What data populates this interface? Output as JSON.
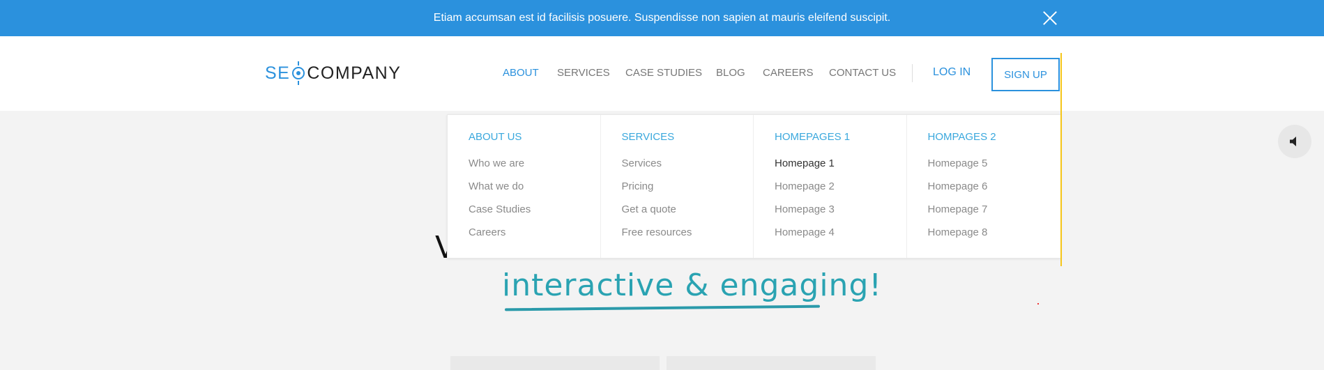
{
  "announcement": {
    "text": "Etiam accumsan est id facilisis posuere. Suspendisse non sapien at mauris eleifend suscipit.",
    "close_icon": "close-icon"
  },
  "logo": {
    "part1": "SE",
    "part2": "COMPANY"
  },
  "nav": {
    "items": [
      {
        "label": "ABOUT",
        "active": true
      },
      {
        "label": "SERVICES"
      },
      {
        "label": "CASE STUDIES"
      },
      {
        "label": "BLOG"
      },
      {
        "label": "CAREERS"
      },
      {
        "label": "CONTACT US"
      }
    ],
    "login": "LOG IN",
    "signup": "SIGN UP"
  },
  "megamenu": {
    "columns": [
      {
        "heading": "ABOUT US",
        "items": [
          "Who we are",
          "What we do",
          "Case Studies",
          "Careers"
        ]
      },
      {
        "heading": "SERVICES",
        "items": [
          "Services",
          "Pricing",
          "Get a quote",
          "Free resources"
        ]
      },
      {
        "heading": "HOMEPAGES 1",
        "items": [
          "Homepage 1",
          "Homepage 2",
          "Homepage 3",
          "Homepage 4"
        ],
        "current": "Homepage 1"
      },
      {
        "heading": "HOMPAGES 2",
        "items": [
          "Homepage 5",
          "Homepage 6",
          "Homepage 7",
          "Homepage 8"
        ]
      }
    ]
  },
  "hero": {
    "line1_partial": "V",
    "line2": "interactive & engaging!"
  },
  "sound_icon": "speaker-icon",
  "colors": {
    "primary": "#2b91dd",
    "accent_teal": "#2aa3b2",
    "yellow": "#f5c518"
  }
}
